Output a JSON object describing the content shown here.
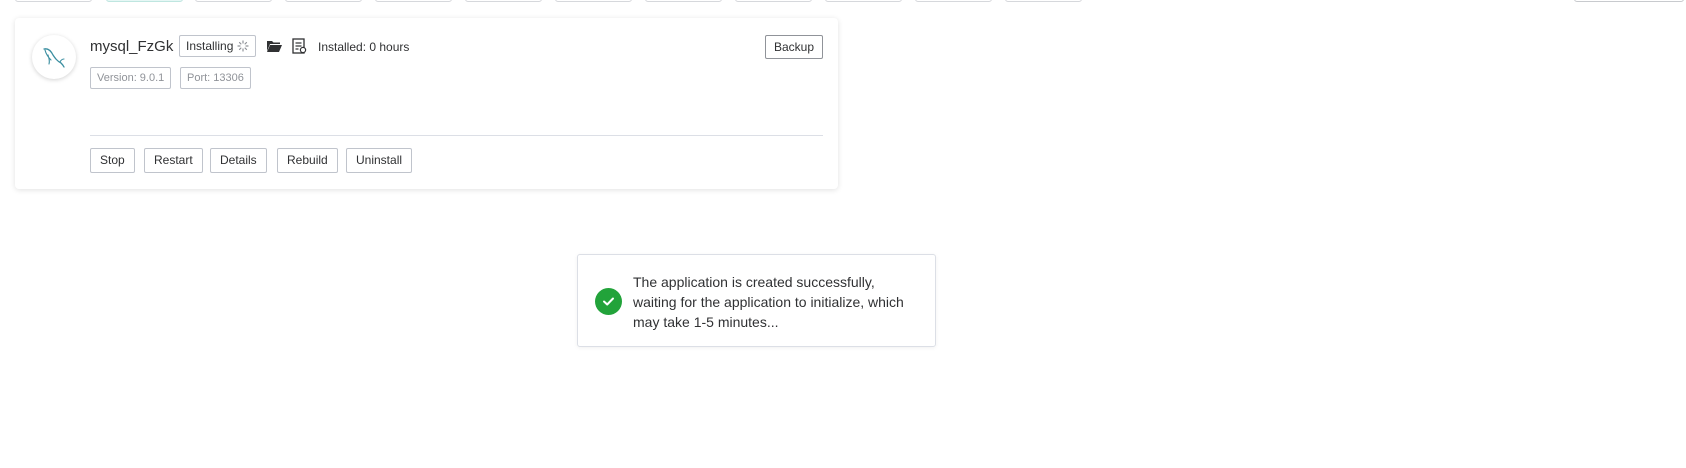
{
  "app": {
    "name": "mysql_FzGk",
    "status": "Installing",
    "installed_time": "Installed: 0 hours",
    "version_tag": "Version: 9.0.1",
    "port_tag": "Port: 13306",
    "backup_label": "Backup",
    "icon": "mysql-dolphin-icon"
  },
  "actions": [
    "Stop",
    "Restart",
    "Details",
    "Rebuild",
    "Uninstall"
  ],
  "toast": {
    "message": "The application is created successfully, waiting for the application to initialize, which may take 1-5 minutes...",
    "icon": "success-check-icon",
    "color": "#22a33a"
  },
  "colors": {
    "accent": "#3a8ea0",
    "success": "#22a33a",
    "border": "#c0c4cc"
  }
}
